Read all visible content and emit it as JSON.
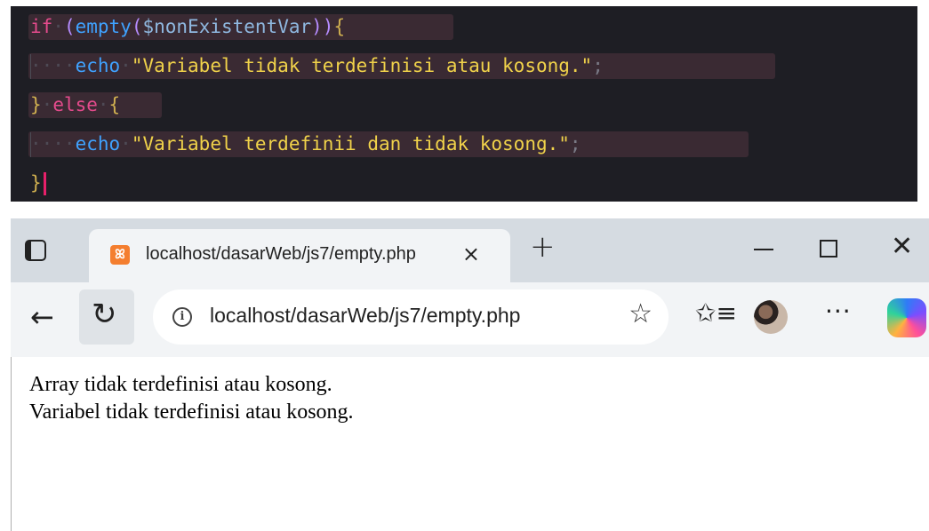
{
  "editor": {
    "line1": {
      "if": "if",
      "empty": "empty",
      "var": "$nonExistentVar"
    },
    "line2": {
      "echo": "echo",
      "str": "\"Variabel tidak terdefinisi atau kosong.\""
    },
    "line3": {
      "else": "else"
    },
    "line4": {
      "echo": "echo",
      "str": "\"Variabel terdefinii dan tidak kosong.\""
    }
  },
  "browser": {
    "tab_title": "localhost/dasarWeb/js7/empty.php",
    "tab_close": "×",
    "new_tab": "+",
    "url": "localhost/dasarWeb/js7/empty.php",
    "icons": [
      "tab-actions-icon",
      "xampp-favicon",
      "back-icon",
      "reload-icon",
      "info-icon",
      "star-icon",
      "favorites-icon",
      "profile-avatar",
      "more-icon",
      "copilot-icon"
    ]
  },
  "page": {
    "line1": "Array tidak terdefinisi atau kosong.",
    "line2": "Variabel tidak terdefinisi atau kosong."
  }
}
